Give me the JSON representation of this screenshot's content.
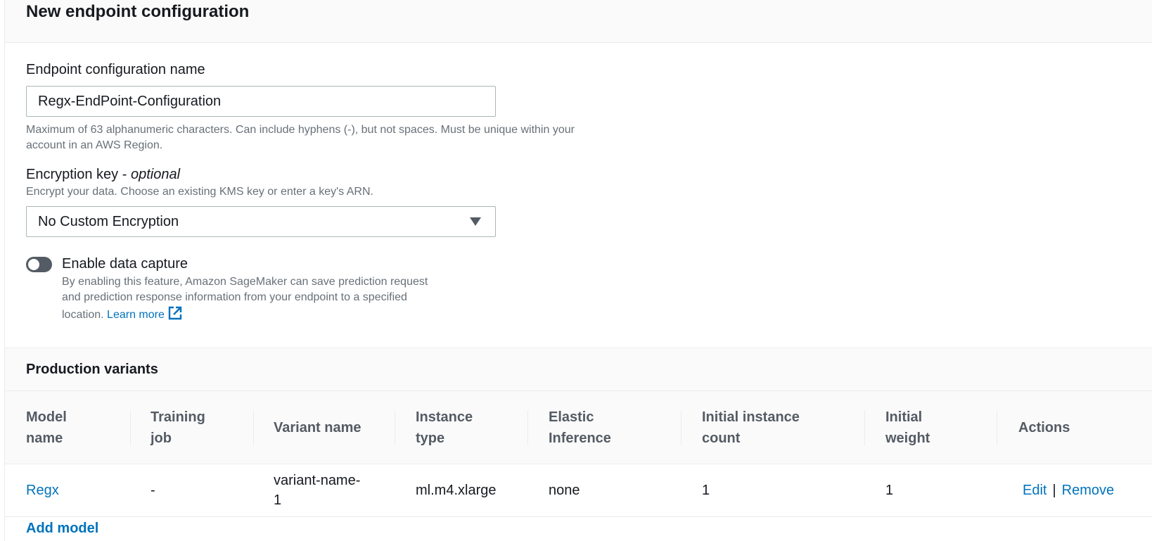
{
  "panel": {
    "title": "New endpoint configuration"
  },
  "form": {
    "name_label": "Endpoint configuration name",
    "name_value": "Regx-EndPoint-Configuration",
    "name_hint_line1": "Maximum of 63 alphanumeric characters. Can include hyphens (-), but not spaces. Must be unique within your",
    "name_hint_line2": "account in an AWS Region.",
    "encryption_label": "Encryption key",
    "encryption_optional": "optional",
    "encryption_hint": "Encrypt your data. Choose an existing KMS key or enter a key's ARN.",
    "encryption_value": "No Custom Encryption",
    "capture_label": "Enable data capture",
    "capture_desc_line1": "By enabling this feature, Amazon SageMaker can save prediction request",
    "capture_desc_line2": "and prediction response information from your endpoint to a specified",
    "capture_desc_line3": "location.",
    "learn_more": "Learn more",
    "capture_enabled": false
  },
  "variants": {
    "title": "Production variants",
    "columns": {
      "model_name": [
        "Model",
        "name"
      ],
      "training_job": [
        "Training",
        "job"
      ],
      "variant_name": "Variant name",
      "instance_type": [
        "Instance",
        "type"
      ],
      "elastic_inference": [
        "Elastic",
        "Inference"
      ],
      "initial_instance_count": [
        "Initial instance",
        "count"
      ],
      "initial_weight": [
        "Initial",
        "weight"
      ],
      "actions": "Actions"
    },
    "rows": [
      {
        "model_name": "Regx",
        "training_job": "-",
        "variant_name_line1": "variant-name-",
        "variant_name_line2": "1",
        "instance_type": "ml.m4.xlarge",
        "elastic_inference": "none",
        "initial_instance_count": "1",
        "initial_weight": "1",
        "edit": "Edit",
        "separator": "|",
        "remove": "Remove"
      }
    ],
    "add_model": "Add model"
  },
  "colors": {
    "link": "#0073bb",
    "toggle_off": "#545b64",
    "header_bg": "#fafafa"
  },
  "icons": {
    "caret": "caret-down-icon",
    "external_link": "external-link-icon"
  }
}
